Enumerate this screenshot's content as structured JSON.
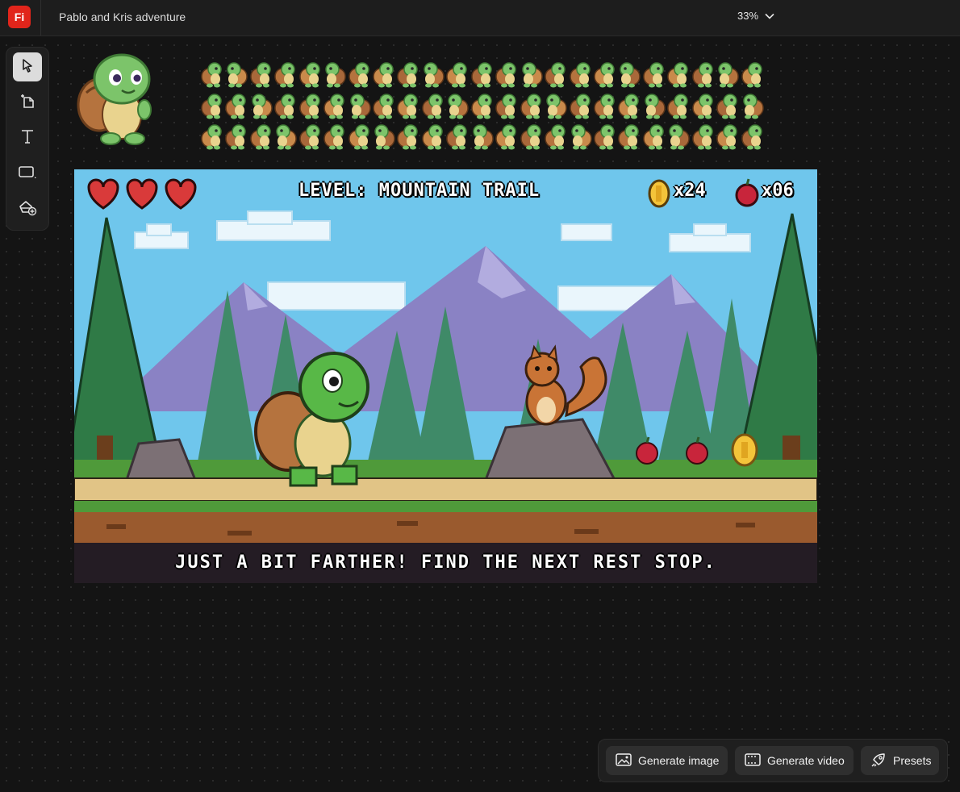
{
  "app": {
    "logo_text": "Fi",
    "document_title": "Pablo and Kris adventure",
    "zoom_label": "33%"
  },
  "toolbar": {
    "tools": [
      {
        "name": "select-tool",
        "icon": "pointer-icon",
        "active": true
      },
      {
        "name": "artboard-tool",
        "icon": "artboard-icon"
      },
      {
        "name": "text-tool",
        "icon": "text-icon"
      },
      {
        "name": "shape-tool",
        "icon": "rectangle-icon"
      },
      {
        "name": "generate-fill-tool",
        "icon": "bucket-add-icon"
      }
    ]
  },
  "game": {
    "hearts": 3,
    "level_label": "LEVEL: MOUNTAIN TRAIL",
    "coins_label": "x24",
    "apples_label": "x06",
    "dialog": "JUST A BIT FARTHER! FIND THE NEXT REST STOP."
  },
  "actions": {
    "generate_image": "Generate image",
    "generate_video": "Generate video",
    "presets": "Presets"
  },
  "colors": {
    "brand": "#e1251b",
    "sky": "#6fc6ec",
    "mountain": "#8a82c4",
    "grass": "#4caf50"
  }
}
